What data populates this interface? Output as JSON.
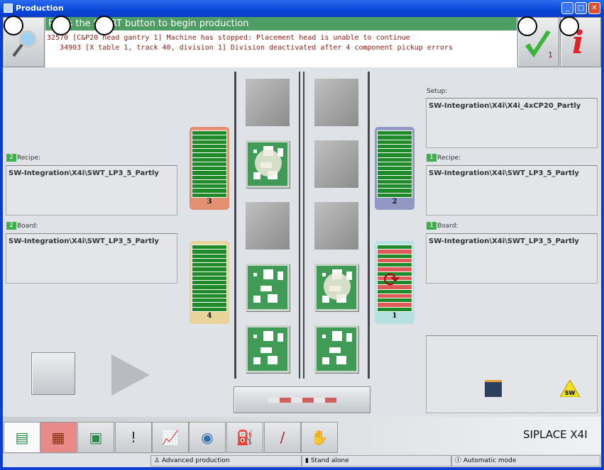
{
  "window": {
    "title": "Production"
  },
  "header": {
    "instruction": "Press the START button to begin production",
    "messages": [
      "32570 [C&P20 head gantry 1] Machine has stopped: Placement head is unable to continue",
      "   34903 [X table 1, track 40, division 1] Division deactivated after 4 component pickup errors"
    ],
    "acknowledge_count": "1",
    "icons": [
      "magnifier-icon",
      "checkmark-icon",
      "info-icon"
    ]
  },
  "left": {
    "recipe_label": "Recipe:",
    "recipe_value": "SW-Integration\\X4i\\SWT_LP3_5_Partly",
    "board_label": "Board:",
    "board_value": "SW-Integration\\X4i\\SWT_LP3_5_Partly",
    "track_badge": "2"
  },
  "right": {
    "setup_label": "Setup:",
    "setup_value": "SW-Integration\\X4i\\X4i_4xCP20_Partly",
    "recipe_label": "Recipe:",
    "recipe_value": "SW-Integration\\X4i\\SWT_LP3_5_Partly",
    "board_label": "Board:",
    "board_value": "SW-Integration\\X4i\\SWT_LP3_5_Partly",
    "track_badge": "1",
    "warning_text": "SW"
  },
  "feeders": [
    {
      "num": "3",
      "color": "#e38f72"
    },
    {
      "num": "4",
      "color": "#e8d39a"
    },
    {
      "num": "2",
      "color": "#9198c4"
    },
    {
      "num": "1",
      "color": "#b7e0e0"
    }
  ],
  "toolbar": {
    "tabs": [
      "boards-stack-icon",
      "feeder-grid-icon",
      "pcb-icon",
      "alarm-list-icon",
      "chart-icon",
      "camera-icon",
      "oil-can-icon",
      "nozzle-icon",
      "hand-gear-icon"
    ],
    "brand": "SIPLACE X4I"
  },
  "statusbar": {
    "mode": "Advanced production",
    "line": "Stand alone",
    "operation": "Automatic mode"
  },
  "colors": {
    "message_bar": "#4e9d64",
    "message_text": "#8a1a12",
    "pcb": "#3f9b55"
  }
}
